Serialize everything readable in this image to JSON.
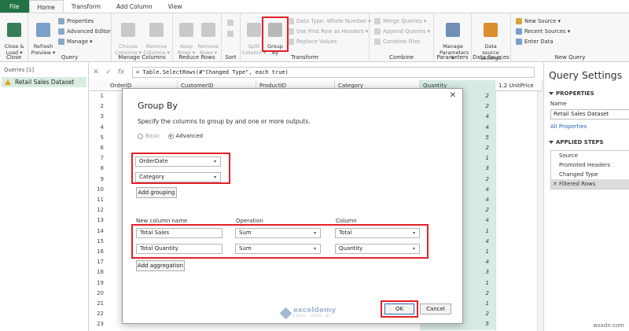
{
  "tabs": [
    "File",
    "Home",
    "Transform",
    "Add Column",
    "View"
  ],
  "ribbon": {
    "close": {
      "btn": "Close &\nLoad ▾",
      "label": "Close"
    },
    "query": {
      "refresh": "Refresh\nPreview ▾",
      "properties": "Properties",
      "advanced_editor": "Advanced Editor",
      "manage": "Manage ▾",
      "label": "Query"
    },
    "manage_columns": {
      "choose": "Choose\nColumns ▾",
      "remove": "Remove\nColumns ▾",
      "label": "Manage Columns"
    },
    "reduce_rows": {
      "keep": "Keep\nRows ▾",
      "remove": "Remove\nRows ▾",
      "label": "Reduce Rows"
    },
    "sort": {
      "label": "Sort"
    },
    "transform": {
      "split": "Split\nColumn ▾",
      "group_by": "Group\nBy",
      "data_type": "Data Type: Whole Number ▾",
      "first_row": "Use First Row as Headers ▾",
      "replace": "Replace Values",
      "label": "Transform"
    },
    "combine": {
      "merge": "Merge Queries ▾",
      "append": "Append Queries ▾",
      "combine_files": "Combine Files",
      "label": "Combine"
    },
    "parameters": {
      "manage": "Manage\nParameters ▾",
      "label": "Parameters"
    },
    "data_sources": {
      "settings": "Data source\nsettings",
      "label": "Data Sources"
    },
    "new_query": {
      "new_source": "New Source ▾",
      "recent_sources": "Recent Sources ▾",
      "enter_data": "Enter Data",
      "label": "New Query"
    }
  },
  "queries": {
    "header": "Queries [1]",
    "items": [
      "Retail Sales Dataset"
    ]
  },
  "formula": {
    "text": "= Table.SelectRows(#\"Changed Type\", each true)"
  },
  "grid": {
    "columns": [
      "OrderID",
      "CustomerID",
      "ProductID",
      "Category",
      "Quantity",
      "1.2  UnitPrice"
    ],
    "rows": [
      "1",
      "2",
      "3",
      "4",
      "5",
      "6",
      "7",
      "8",
      "9",
      "10",
      "11",
      "12",
      "13",
      "14",
      "15",
      "16",
      "17",
      "18",
      "19",
      "20",
      "21",
      "22",
      "23"
    ],
    "quantity": [
      "2",
      "2",
      "4",
      "4",
      "5",
      "2",
      "1",
      "3",
      "2",
      "4",
      "4",
      "2",
      "4",
      "1",
      "4",
      "1",
      "4",
      "3",
      "1",
      "2",
      "1",
      "2",
      "5"
    ]
  },
  "query_settings": {
    "title": "Query Settings",
    "properties_label": "PROPERTIES",
    "name_label": "Name",
    "name_value": "Retail Sales Dataset",
    "all_properties": "All Properties",
    "applied_steps_label": "APPLIED STEPS",
    "steps": [
      "Source",
      "Promoted Headers",
      "Changed Type",
      "Filtered Rows"
    ]
  },
  "dialog": {
    "title": "Group By",
    "close": "✕",
    "description": "Specify the columns to group by and one or more outputs.",
    "basic": "Basic",
    "advanced": "Advanced",
    "group_fields": [
      "OrderDate",
      "Category"
    ],
    "add_grouping": "Add grouping",
    "headers": {
      "new_column": "New column name",
      "operation": "Operation",
      "column": "Column"
    },
    "aggregations": [
      {
        "name": "Total Sales",
        "operation": "Sum",
        "column": "Total"
      },
      {
        "name": "Total Quantity",
        "operation": "Sum",
        "column": "Quantity"
      }
    ],
    "add_aggregation": "Add aggregation",
    "ok": "OK",
    "cancel": "Cancel"
  },
  "watermark": {
    "name": "exceldemy",
    "tagline": "EXCEL · DATA · BI"
  },
  "site": "wsxdn.com"
}
